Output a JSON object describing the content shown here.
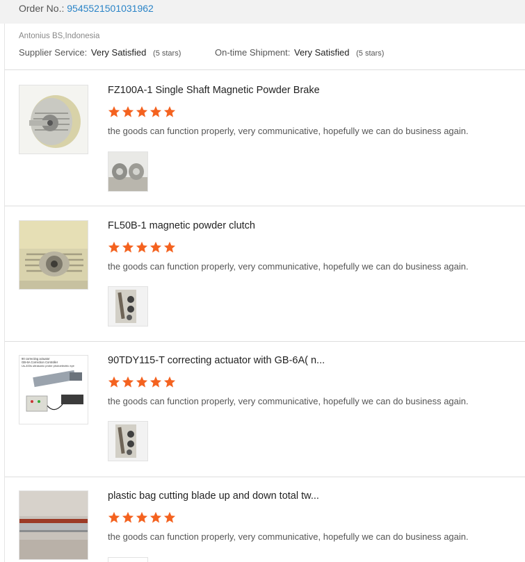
{
  "order": {
    "label": "Order No.:",
    "number": "9545521501031962"
  },
  "supplier": {
    "buyer": "Antonius BS,Indonesia",
    "service_label": "Supplier Service:",
    "service_value": "Very Satisfied",
    "service_stars": "(5 stars)",
    "shipment_label": "On-time Shipment:",
    "shipment_value": "Very Satisfied",
    "shipment_stars": "(5 stars)"
  },
  "colors": {
    "star": "#f4621f",
    "link": "#2a84c7"
  },
  "products": [
    {
      "title": "FZ100A-1 Single Shaft Magnetic Powder Brake",
      "rating": 5,
      "comment": "the goods can function properly, very communicative, hopefully we can do business again.",
      "image_icon": "magnetic-brake-photo",
      "review_icon": "review-photo-brakes"
    },
    {
      "title": "FL50B-1 magnetic powder clutch",
      "rating": 5,
      "comment": "the goods can function properly, very communicative, hopefully we can do business again.",
      "image_icon": "powder-clutch-photo",
      "review_icon": "review-photo-parts"
    },
    {
      "title": "90TDY115-T correcting actuator with GB-6A( n...",
      "rating": 5,
      "comment": "the goods can function properly, very communicative, hopefully we can do business again.",
      "image_icon": "actuator-kit-photo",
      "image_caption": "90 correcting actuator\nGB-6A Correction Controller\nUs-400s ultrasonic probe photoelectric eye",
      "review_icon": "review-photo-parts"
    },
    {
      "title": "plastic bag cutting blade up and down total tw...",
      "rating": 5,
      "comment": "the goods can function properly, very communicative, hopefully we can do business again.",
      "image_icon": "cutting-blade-photo",
      "review_icon": "review-photo-blade"
    }
  ]
}
